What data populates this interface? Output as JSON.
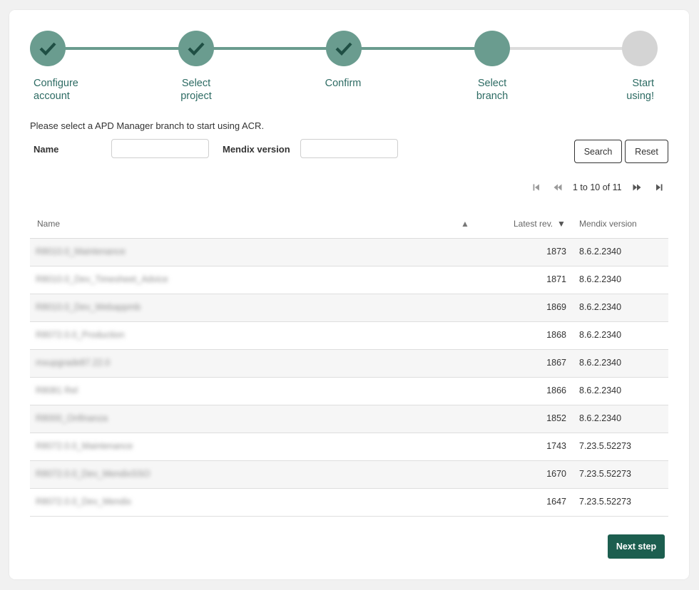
{
  "colors": {
    "completed": "#6a9c8f",
    "checkmark": "#1f4f44",
    "pending": "#d4d4d4",
    "label": "#2d6b63",
    "primary_button": "#1c5e4f"
  },
  "stepper": {
    "steps": [
      {
        "line1": "Configure",
        "line2": "account",
        "status": "completed"
      },
      {
        "line1": "Select",
        "line2": "project",
        "status": "completed"
      },
      {
        "line1": "Confirm",
        "line2": "",
        "status": "completed"
      },
      {
        "line1": "Select",
        "line2": "branch",
        "status": "current"
      },
      {
        "line1": "Start",
        "line2": "using!",
        "status": "pending"
      }
    ]
  },
  "intro_text": "Please select a APD Manager branch to start using ACR.",
  "filters": {
    "name_label": "Name",
    "name_value": "",
    "mendix_label": "Mendix version",
    "mendix_value": "",
    "search_label": "Search",
    "reset_label": "Reset"
  },
  "pagination": {
    "text": "1 to 10 of 11",
    "icons": [
      "first-page-icon",
      "previous-page-icon",
      "next-page-icon",
      "last-page-icon"
    ]
  },
  "table": {
    "headers": {
      "name": "Name",
      "sort_name": "▲",
      "latest_rev": "Latest rev.",
      "sort_rev": "▼",
      "mendix_version": "Mendix version"
    },
    "rows": [
      {
        "name": "R8010.0_Maintenance",
        "rev": "1873",
        "version": "8.6.2.2340"
      },
      {
        "name": "R8010.0_Dev_Timesheet_Advice",
        "rev": "1871",
        "version": "8.6.2.2340"
      },
      {
        "name": "R8010.0_Dev_Webappmb",
        "rev": "1869",
        "version": "8.6.2.2340"
      },
      {
        "name": "R8072.0.0_Production",
        "rev": "1868",
        "version": "8.6.2.2340"
      },
      {
        "name": "mxupgrade87.22.0",
        "rev": "1867",
        "version": "8.6.2.2340"
      },
      {
        "name": "R8081 Rel",
        "rev": "1866",
        "version": "8.6.2.2340"
      },
      {
        "name": "R8000_Onfinanza",
        "rev": "1852",
        "version": "8.6.2.2340"
      },
      {
        "name": "R8072.0.0_Maintenance",
        "rev": "1743",
        "version": "7.23.5.52273"
      },
      {
        "name": "R8072.0.0_Dev_MendixSSO",
        "rev": "1670",
        "version": "7.23.5.52273"
      },
      {
        "name": "R8072.0.0_Dev_Mendix",
        "rev": "1647",
        "version": "7.23.5.52273"
      }
    ]
  },
  "next_button_label": "Next step"
}
